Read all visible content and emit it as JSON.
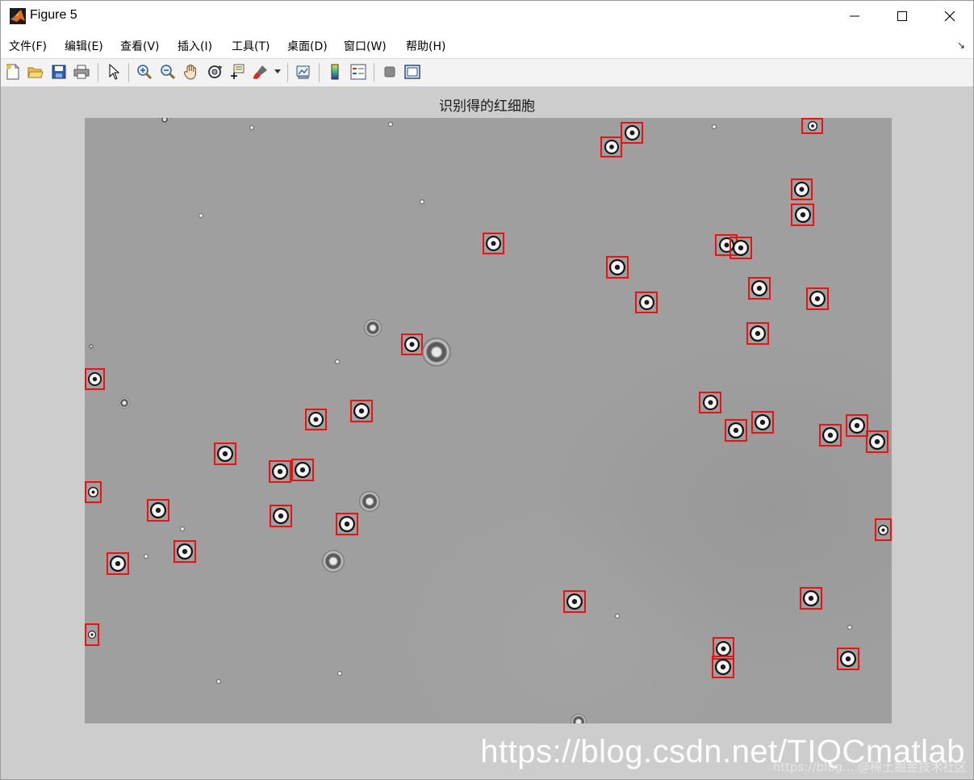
{
  "window": {
    "title": "Figure 5"
  },
  "menu": [
    "文件(F)",
    "编辑(E)",
    "查看(V)",
    "插入(I)",
    "工具(T)",
    "桌面(D)",
    "窗口(W)",
    "帮助(H)"
  ],
  "toolbar": {
    "buttons": [
      "new-figure-icon",
      "open-file-icon",
      "save-icon",
      "print-icon",
      "pointer-icon",
      "zoom-in-icon",
      "zoom-out-icon",
      "pan-hand-icon",
      "rotate-3d-icon",
      "data-cursor-icon",
      "brush-icon",
      "link-plot-icon",
      "colorbar-icon",
      "legend-icon",
      "hide-plot-tools-icon",
      "show-plot-tools-icon"
    ]
  },
  "figure": {
    "title": "识别得的红细胞"
  },
  "watermark": {
    "text": "https://blog.csdn.net/TIQCmatlab",
    "secondary": "https://blog... @稀土掘金技术社区"
  }
}
